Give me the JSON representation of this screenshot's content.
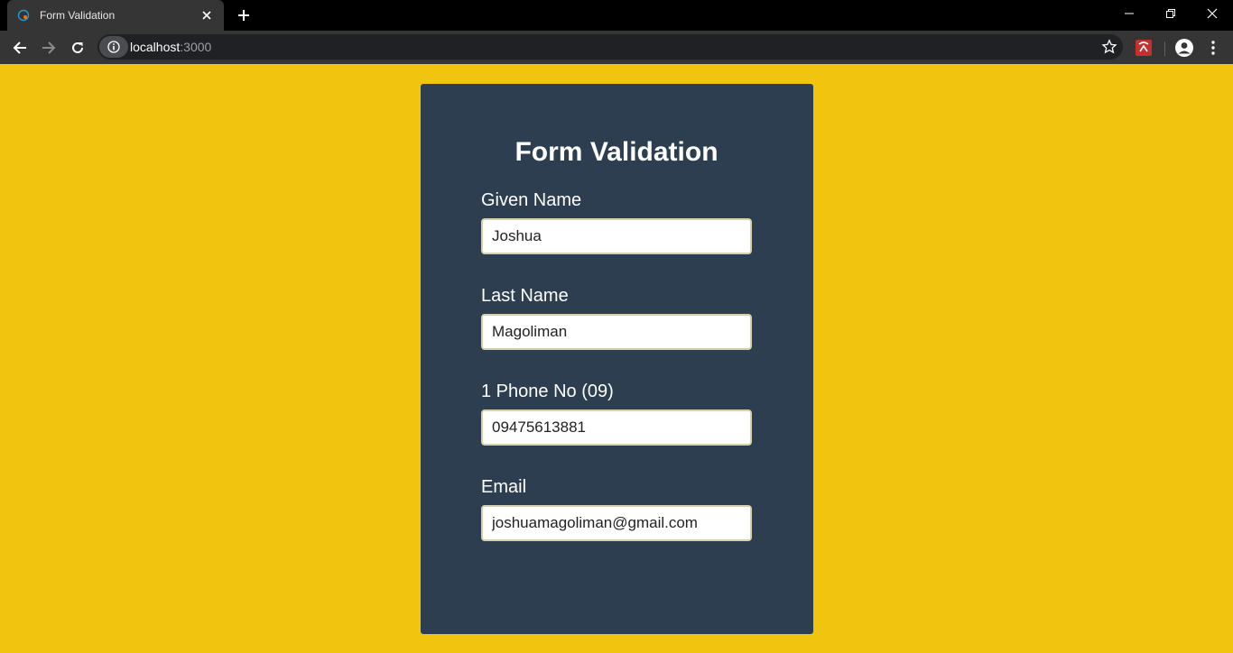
{
  "browser": {
    "tab_title": "Form Validation",
    "url_host": "localhost",
    "url_rest": ":3000",
    "new_tab_label": "+"
  },
  "icons": {
    "favicon": "react-icon",
    "tab_close": "close-icon",
    "back": "back-arrow-icon",
    "forward": "forward-arrow-icon",
    "reload": "reload-icon",
    "site_info": "info-icon",
    "bookmark": "star-icon",
    "extension": "extension-icon",
    "profile": "profile-icon",
    "menu": "more-vert-icon",
    "minimize": "minimize-icon",
    "restore": "restore-icon",
    "close_window": "close-icon"
  },
  "colors": {
    "page_background": "#f1c40f",
    "card_background": "#2c3e50",
    "text": "#ffffff"
  },
  "form": {
    "title": "Form Validation",
    "fields": [
      {
        "label": "Given Name",
        "value": "Joshua"
      },
      {
        "label": "Last Name",
        "value": "Magoliman"
      },
      {
        "label": "1 Phone No (09)",
        "value": "09475613881"
      },
      {
        "label": "Email",
        "value": "joshuamagoliman@gmail.com"
      }
    ]
  }
}
